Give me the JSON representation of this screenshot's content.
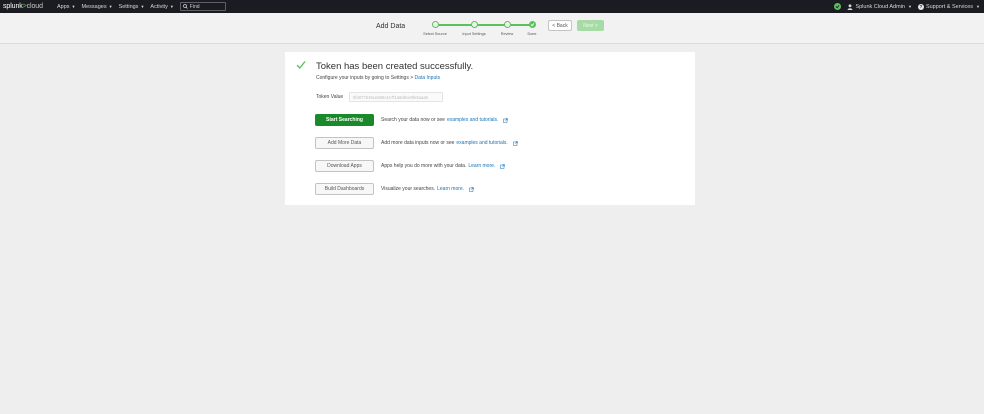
{
  "topbar": {
    "logo": {
      "part1": "splunk",
      "part2": ">",
      "part3": "cloud"
    },
    "nav": [
      "Apps",
      "Messages",
      "Settings",
      "Activity"
    ],
    "find_placeholder": "Find",
    "user": "Splunk Cloud Admin",
    "support": "Support & Services"
  },
  "wizard": {
    "title": "Add Data",
    "steps": [
      "Select Source",
      "Input Settings",
      "Review",
      "Done"
    ],
    "back_label": "< Back",
    "next_label": "Next >"
  },
  "panel": {
    "title": "Token has been created successfully.",
    "subtitle_prefix": "Configure your inputs by going to Settings > ",
    "subtitle_link": "Data Inputs",
    "token_label": "Token Value",
    "token_value": "0f4077b45ce585c4e7f1a9d6ce8fe5aaa0",
    "actions": [
      {
        "button": "Start Searching",
        "desc": "Search your data now or see",
        "link": "examples and tutorials."
      },
      {
        "button": "Add More Data",
        "desc": "Add more data inputs now or see",
        "link": "examples and tutorials."
      },
      {
        "button": "Download Apps",
        "desc": "Apps help you do more with your data.",
        "link": "Learn more."
      },
      {
        "button": "Build Dashboards",
        "desc": "Visualize your searches.",
        "link": "Learn more."
      }
    ]
  },
  "colors": {
    "accent_green": "#5cc05c",
    "primary_button": "#1a8929",
    "link": "#1a73b5",
    "nav_bg": "#1a1c21"
  }
}
